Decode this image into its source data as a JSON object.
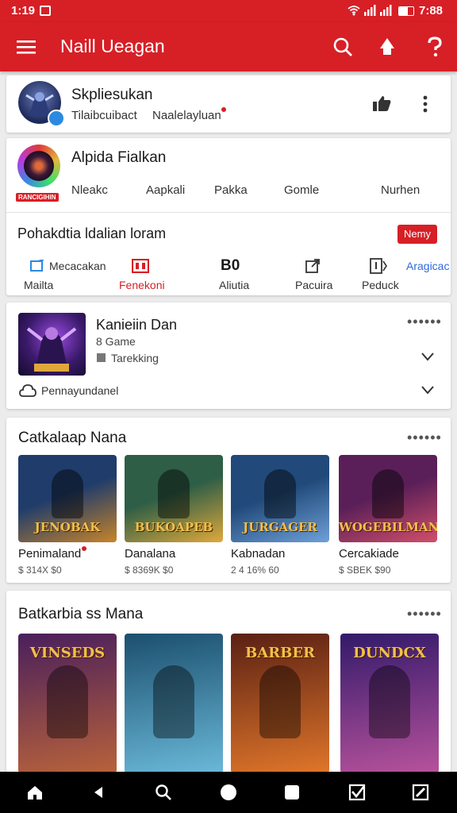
{
  "status": {
    "time": "1:19",
    "right_time": "7:88"
  },
  "appbar": {
    "title": "Naill Ueagan"
  },
  "profile": {
    "name": "Skpliesukan",
    "sub_left": "Tilaibcuibact",
    "sub_right": "Naalelayluan"
  },
  "app_card": {
    "name": "Alpida Fialkan",
    "badge": "RANCIGIHIN",
    "stats": [
      "Nleakc",
      "Aapkali",
      "Pakka",
      "Gomle",
      "Nurhen"
    ]
  },
  "options": {
    "title": "Pohakdtia ldalian loram",
    "button": "Nemy",
    "tabs": [
      {
        "icon": "message-icon",
        "top": "Mecacakan",
        "bottom": "Mailta"
      },
      {
        "icon": "calendar-icon",
        "top": "",
        "bottom": "Fenekoni",
        "accent": true
      },
      {
        "icon": "",
        "top": "B0",
        "bottom": "Aliutia"
      },
      {
        "icon": "share-icon",
        "top": "",
        "bottom": "Pacuira"
      },
      {
        "icon": "info-icon",
        "top": "",
        "bottom": "Peduck"
      },
      {
        "icon": "",
        "top": "Aragicac",
        "bottom": "",
        "link": true
      }
    ]
  },
  "game": {
    "name": "Kanieiin Dan",
    "sub": "8 Game",
    "tag": "Tarekking",
    "footer": "Pennayundanel"
  },
  "section1": {
    "title": "Catkalaap Nana",
    "items": [
      {
        "name": "Penimaland",
        "price": "$ 314X $0",
        "art": "JENOBAK",
        "c1": "#1f3c6b",
        "c2": "#c7842a",
        "dot": true
      },
      {
        "name": "Danalana",
        "price": "$ 8369K $0",
        "art": "BUKOAPEB",
        "c1": "#2e5e46",
        "c2": "#e0a83c"
      },
      {
        "name": "Kabnadan",
        "price": "2 4 16% 60",
        "art": "JURGAGER",
        "c1": "#214a7a",
        "c2": "#6ea0d8"
      },
      {
        "name": "Cercakiade",
        "price": "$ SBEK $90",
        "art": "WOGEBILMAN",
        "c1": "#5a1f58",
        "c2": "#d14f6a"
      }
    ]
  },
  "section2": {
    "title": "Batkarbia ss Mana",
    "items": [
      {
        "art": "VINSEDS",
        "c1": "#4a1f5c",
        "c2": "#b8623a"
      },
      {
        "art": "",
        "c1": "#1c4f6e",
        "c2": "#6ab8d8"
      },
      {
        "art": "BARBER",
        "c1": "#5a2014",
        "c2": "#e0762a"
      },
      {
        "art": "DUNDCX",
        "c1": "#321a6a",
        "c2": "#b8529c"
      }
    ]
  }
}
